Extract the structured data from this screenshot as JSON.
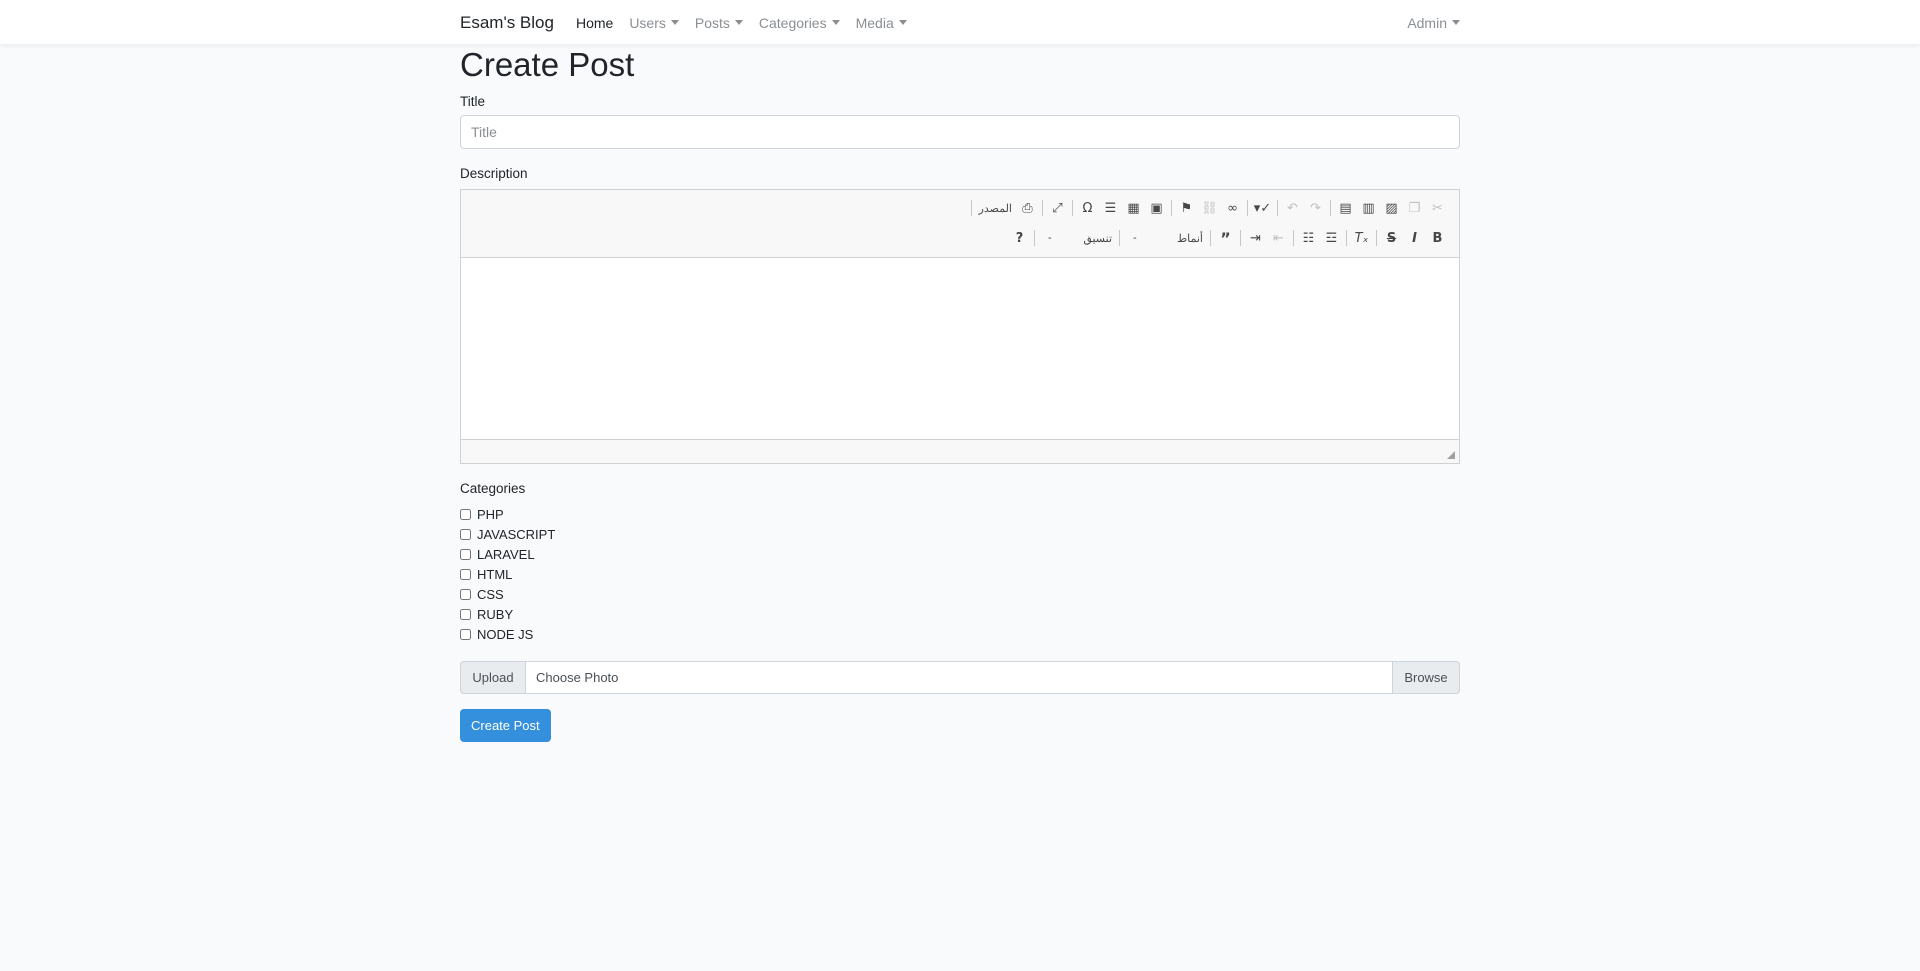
{
  "navbar": {
    "brand": "Esam's Blog",
    "links": [
      {
        "label": "Home",
        "active": true,
        "dropdown": false
      },
      {
        "label": "Users",
        "active": false,
        "dropdown": true
      },
      {
        "label": "Posts",
        "active": false,
        "dropdown": true
      },
      {
        "label": "Categories",
        "active": false,
        "dropdown": true
      },
      {
        "label": "Media",
        "active": false,
        "dropdown": true
      }
    ],
    "user": "Admin"
  },
  "page": {
    "title": "Create Post",
    "title_label": "Title",
    "title_placeholder": "Title",
    "description_label": "Description",
    "categories_label": "Categories",
    "categories": [
      "PHP",
      "JAVASCRIPT",
      "LARAVEL",
      "HTML",
      "CSS",
      "RUBY",
      "NODE JS"
    ],
    "upload_label": "Upload",
    "file_placeholder": "Choose Photo",
    "browse_label": "Browse",
    "submit_label": "Create Post"
  },
  "editor": {
    "source_label": "المصدر",
    "styles_label": "أنماط",
    "format_label": "تنسيق",
    "combo_dash": "-",
    "icons": {
      "cut": "cut-icon",
      "copy": "copy-icon",
      "paste": "paste-icon",
      "paste_text": "paste-text-icon",
      "paste_word": "paste-word-icon",
      "redo": "redo-icon",
      "undo": "undo-icon",
      "spellcheck": "spellcheck-icon",
      "link": "link-icon",
      "unlink": "unlink-icon",
      "anchor": "anchor-icon",
      "image": "image-icon",
      "table": "table-icon",
      "hr": "horizontal-line-icon",
      "special_char": "special-char-icon",
      "maximize": "maximize-icon",
      "source": "source-icon",
      "bold": "bold-icon",
      "italic": "italic-icon",
      "strike": "strikethrough-icon",
      "remove_format": "remove-format-icon",
      "numbered_list": "numbered-list-icon",
      "bulleted_list": "bulleted-list-icon",
      "outdent": "outdent-icon",
      "indent": "indent-icon",
      "blockquote": "blockquote-icon",
      "help": "help-icon"
    }
  }
}
